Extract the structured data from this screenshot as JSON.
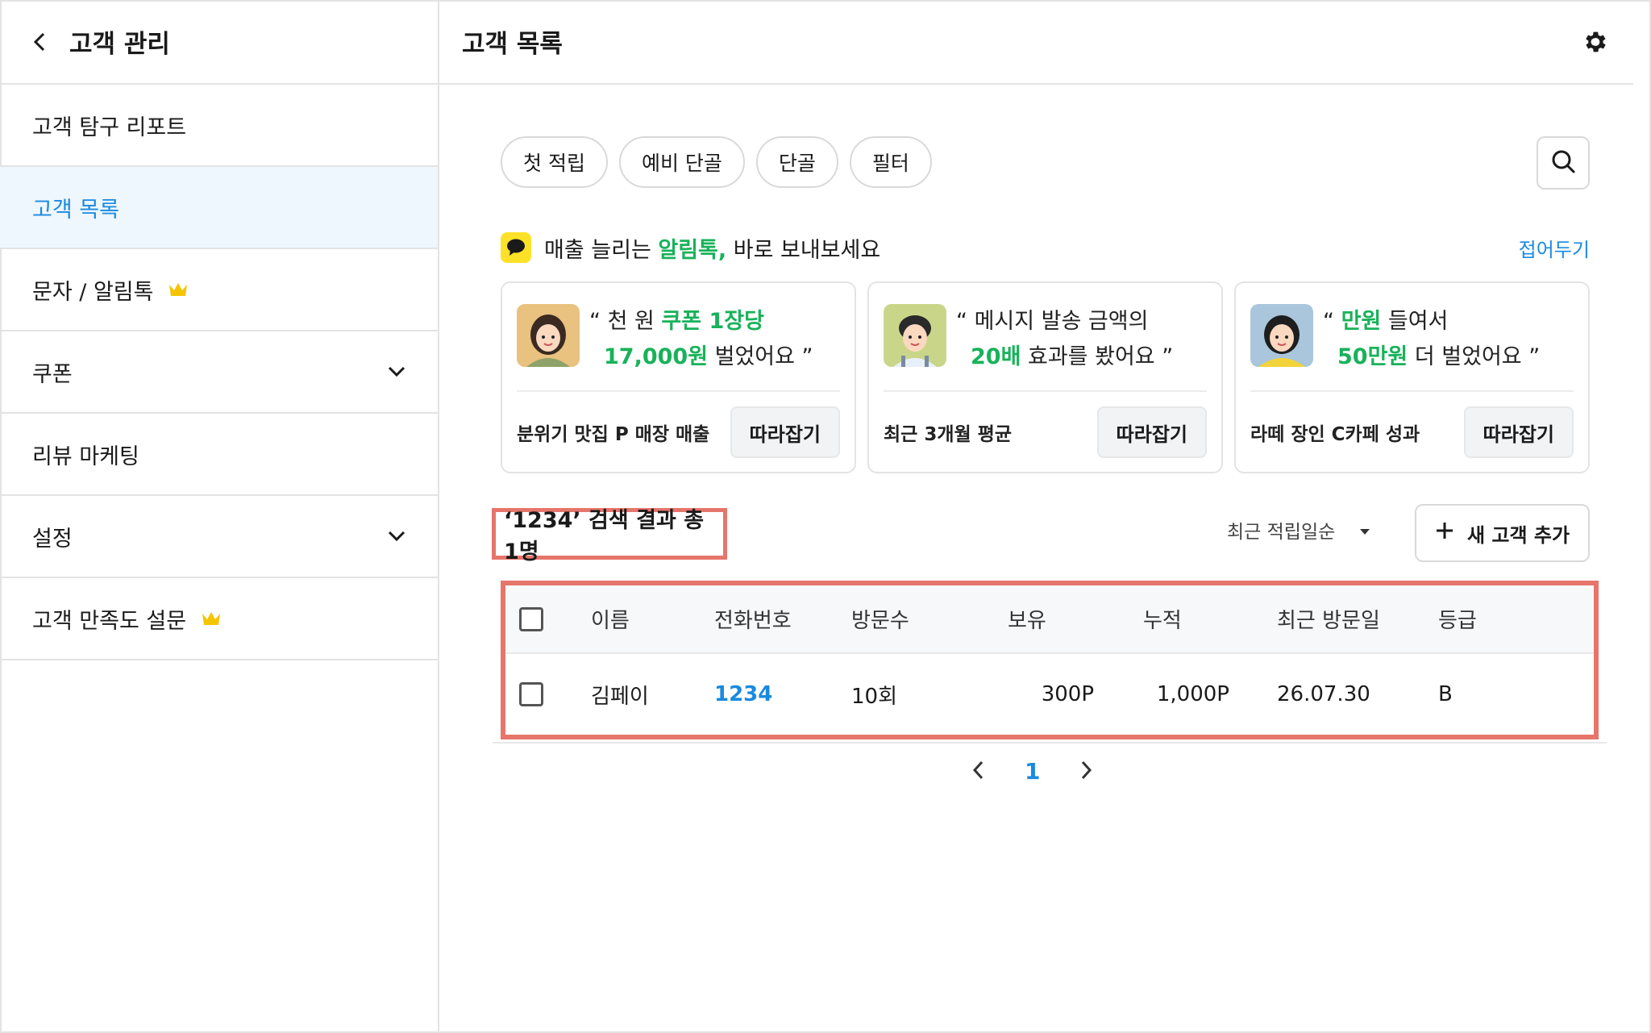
{
  "sidebar": {
    "title": "고객 관리",
    "items": [
      {
        "label": "고객 탐구 리포트"
      },
      {
        "label": "고객 목록"
      },
      {
        "label": "문자 / 알림톡"
      },
      {
        "label": "쿠폰"
      },
      {
        "label": "리뷰 마케팅"
      },
      {
        "label": "설정"
      },
      {
        "label": "고객 만족도 설문"
      }
    ]
  },
  "main": {
    "title": "고객 목록",
    "chips": [
      "첫 적립",
      "예비 단골",
      "단골",
      "필터"
    ],
    "promo": {
      "prefix": "매출 늘리는 ",
      "highlight": "알림톡,",
      "suffix": " 바로 보내보세요",
      "fold": "접어두기"
    },
    "cards": [
      {
        "q1_pre": "“ 천 원 ",
        "q1_hl": "쿠폰 1장당",
        "q1_post": "",
        "q2_hl": "17,000원",
        "q2_post": " 벌었어요 ”",
        "source": "분위기 맛집 P 매장 매출",
        "button": "따라잡기"
      },
      {
        "q1_pre": "“ 메시지 발송 금액의",
        "q1_hl": "",
        "q1_post": "",
        "q2_hl": "20배",
        "q2_post": " 효과를 봤어요  ”",
        "source": "최근 3개월 평균",
        "button": "따라잡기"
      },
      {
        "q1_pre": "“ ",
        "q1_hl": "만원",
        "q1_post": " 들여서",
        "q2_hl": "50만원",
        "q2_post": " 더 벌었어요 ”",
        "source": "라떼 장인 C카페 성과",
        "button": "따라잡기"
      }
    ],
    "result_text": "‘1234’ 검색 결과 총 1명",
    "sort_label": "최근 적립일순",
    "add_button": "새 고객 추가",
    "table": {
      "headers": [
        "이름",
        "전화번호",
        "방문수",
        "보유",
        "누적",
        "최근 방문일",
        "등급"
      ],
      "rows": [
        {
          "name": "김페이",
          "phone": "1234",
          "visits": "10회",
          "held": "300P",
          "accum": "1,000P",
          "last_visit": "26.07.30",
          "grade": "B"
        }
      ]
    },
    "pagination": {
      "current": "1"
    }
  },
  "colors": {
    "accent": "#1a8ae0",
    "green": "#18b25a",
    "highlight_box": "#e6756b",
    "kakao": "#fde128",
    "crown": "#f5c400"
  },
  "icons": [
    "back-icon",
    "gear-icon",
    "search-icon",
    "chat-bubble-icon",
    "crown-icon",
    "chevron-down-icon",
    "plus-icon",
    "caret-down-icon",
    "chevron-left-icon",
    "chevron-right-icon"
  ]
}
